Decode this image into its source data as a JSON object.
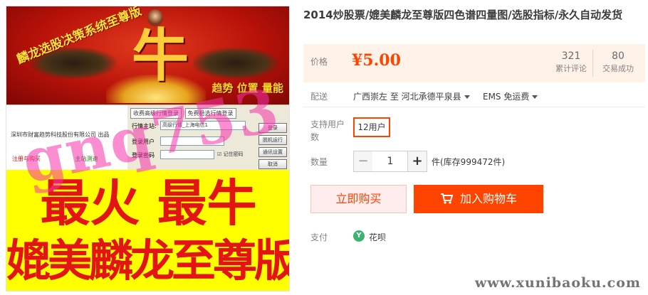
{
  "product_image": {
    "banner_title": "麟龙选股决策系统至尊版",
    "banner_char": "牛",
    "banner_slogan": "趋势 位置 量能",
    "software": {
      "tab1": "收费高级行情登录",
      "tab2": "免费稳选行情登录",
      "company": "深圳市财富趋势科技股份有限公司 出品",
      "link_register": "注册与购买",
      "link_home": "主站测速",
      "row_server_label": "行情主站:",
      "row_server_value": "高级行情_上海电信1",
      "row_user_label": "登录用户",
      "row_pass_label": "登录密码",
      "remember_label": "记住密码",
      "btn_login": "登录",
      "btn_offline": "脱机运行",
      "btn_settings": "通讯设置",
      "btn_cancel": "取消"
    },
    "watermark": "gnq753",
    "promo_line1": "最火 最牛",
    "promo_line2": "媲美麟龙至尊版"
  },
  "product": {
    "title": "2014炒股票/媲美麟龙至尊版四色谱四量图/选股指标/永久自动发货"
  },
  "price": {
    "label": "价格",
    "value": "¥5.00",
    "reviews_count": "321",
    "reviews_label": "累计评论",
    "deals_count": "80",
    "deals_label": "交易成功"
  },
  "shipping": {
    "label": "配送",
    "route": "广西崇左 至  河北承德平泉县",
    "method": "EMS 免运费"
  },
  "options": {
    "label": "支持用户数",
    "selected": "12用户"
  },
  "quantity": {
    "label": "数量",
    "minus": "−",
    "value": "1",
    "plus": "+",
    "stock": "件(库存999472件)"
  },
  "actions": {
    "buy_now": "立即购买",
    "add_to_cart": "加入购物车"
  },
  "payment": {
    "label": "支付",
    "icon_glyph": "Y",
    "method": "花呗"
  },
  "site_watermark": "www.xunibaoku.com",
  "colors": {
    "accent": "#ff4400",
    "price_bg": "#fff2e8",
    "promo_yellow": "#ffff00",
    "promo_red": "#e31414"
  }
}
